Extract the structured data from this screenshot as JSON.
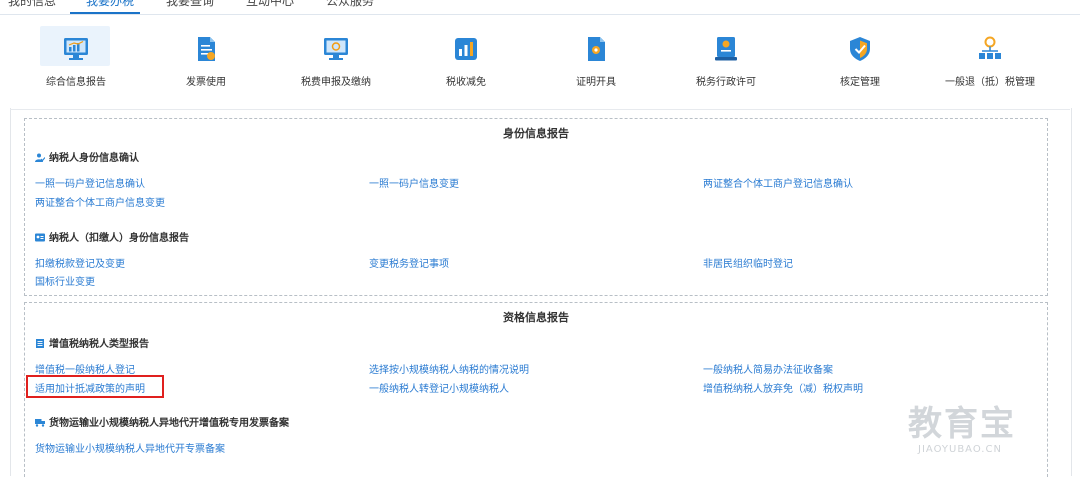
{
  "topnav": {
    "tabs": [
      {
        "label": "我的信息"
      },
      {
        "label": "我要办税"
      },
      {
        "label": "我要查询"
      },
      {
        "label": "互动中心"
      },
      {
        "label": "公众服务"
      }
    ],
    "active_tab": "我要办税"
  },
  "services": [
    {
      "label": "综合信息报告",
      "icon": "report-monitor-icon"
    },
    {
      "label": "发票使用",
      "icon": "invoice-document-icon"
    },
    {
      "label": "税费申报及缴纳",
      "icon": "declaration-monitor-icon"
    },
    {
      "label": "税收减免",
      "icon": "tax-reduction-chart-icon"
    },
    {
      "label": "证明开具",
      "icon": "certificate-icon"
    },
    {
      "label": "税务行政许可",
      "icon": "license-icon"
    },
    {
      "label": "核定管理",
      "icon": "shield-check-icon"
    },
    {
      "label": "一般退（抵）税管理",
      "icon": "org-tree-icon"
    }
  ],
  "identity_section": {
    "title": "身份信息报告",
    "group1": {
      "heading": "纳税人身份信息确认",
      "links": [
        "一照一码户登记信息确认",
        "一照一码户信息变更",
        "两证整合个体工商户登记信息确认",
        "两证整合个体工商户信息变更"
      ]
    },
    "group2": {
      "heading": "纳税人（扣缴人）身份信息报告",
      "links": [
        "扣缴税款登记及变更",
        "变更税务登记事项",
        "非居民组织临时登记",
        "国标行业变更"
      ]
    }
  },
  "qualification_section": {
    "title": "资格信息报告",
    "group1": {
      "heading": "增值税纳税人类型报告",
      "links": [
        "增值税一般纳税人登记",
        "选择按小规模纳税人纳税的情况说明",
        "一般纳税人简易办法征收备案",
        "适用加计抵减政策的声明",
        "一般纳税人转登记小规模纳税人",
        "增值税纳税人放弃免（减）税权声明"
      ]
    },
    "group2": {
      "heading": "货物运输业小规模纳税人异地代开增值税专用发票备案",
      "links": [
        "货物运输业小规模纳税人异地代开专票备案"
      ]
    }
  },
  "watermark": {
    "main": "教育宝",
    "sub": "JIAOYUBAO.CN"
  },
  "colors": {
    "accent": "#1a73c8",
    "link": "#2a7bd2",
    "highlight": "#e0201e"
  }
}
